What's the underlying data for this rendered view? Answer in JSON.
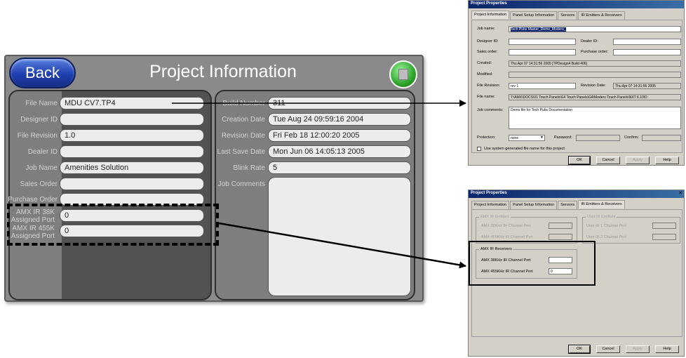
{
  "panel": {
    "back_label": "Back",
    "title": "Project Information",
    "home_icon": "home-icon",
    "left_rows": [
      {
        "label": "File Name",
        "value": "MDU CV7.TP4"
      },
      {
        "label": "Designer ID",
        "value": ""
      },
      {
        "label": "File Revision",
        "value": "1.0"
      },
      {
        "label": "Dealer ID",
        "value": ""
      },
      {
        "label": "Job Name",
        "value": "Amenities Solution"
      },
      {
        "label": "Sales Order",
        "value": ""
      },
      {
        "label": "Purchase Order",
        "value": ""
      },
      {
        "label": "AMX IR 38K Assigned Port",
        "value": "0"
      },
      {
        "label": "AMX IR 455K Assigned Port",
        "value": "0"
      }
    ],
    "right_rows": [
      {
        "label": "Build Number",
        "value": "311"
      },
      {
        "label": "Creation Date",
        "value": "Tue Aug 24 09:59:16 2004"
      },
      {
        "label": "Revision Date",
        "value": "Fri Feb 18 12:00:20 2005"
      },
      {
        "label": "Last Save Date",
        "value": "Mon Jun 06 14:05:13 2005"
      },
      {
        "label": "Blink Rate",
        "value": "5"
      },
      {
        "label": "Job Comments",
        "value": ""
      }
    ]
  },
  "dialog1": {
    "title": "Project Properties",
    "tabs": [
      "Project Information",
      "Panel Setup Information",
      "Sensors",
      "IR Emitters & Receivers"
    ],
    "job_name_label": "Job name:",
    "job_name_value": "Tech Pubs Master_Demo_Modero_",
    "designer_id_label": "Designer ID:",
    "dealer_id_label": "Dealer ID:",
    "sales_order_label": "Sales order:",
    "purchase_order_label": "Purchase order:",
    "created_label": "Created:",
    "created_value": "Thu Apr 07 14:31:56 2005 [TPDesign4 Build 406]",
    "modified_label": "Modified:",
    "file_revision_label": "File Revision:",
    "file_revision_value": "rev 1",
    "revision_date_label": "Revision Date:",
    "revision_date_value": "Thu Apr 07 14:31:56 2005",
    "file_name_label": "File name:",
    "file_name_value": "T:\\AMX\\DOCS\\01 Touch Panels\\G4 Touch Panels\\G4\\Modero Touch Panels\\NXT 6.10\\D",
    "job_comments_label": "Job comments:",
    "job_comments_value": "Demo file for Tech Pubs Documentation",
    "protection_label": "Protection:",
    "protection_value": "none",
    "password_label": "Password:",
    "confirm_label": "Confirm:",
    "checkbox_label": "Use system generated file name for this project",
    "ok": "OK",
    "cancel": "Cancel",
    "apply": "Apply",
    "help": "Help"
  },
  "dialog2": {
    "title": "Project Properties",
    "tabs": [
      "Project Information",
      "Panel Setup Information",
      "Sensors",
      "IR Emitters & Receivers"
    ],
    "emitters_group": "AMX IR Emitters",
    "emitter_rows": [
      "AMX 38KHz IR Channel Port",
      "AMX 455KHz IR Channel Port"
    ],
    "user_emitters_group": "User IR Emitters",
    "user_emitter_rows": [
      "User IR 1 Channel Port",
      "User IR 2 Channel Port"
    ],
    "receivers_group": "AMX IR Receivers",
    "receiver_rows": [
      {
        "label": "AMX 38KHz IR Channel Port",
        "value": ""
      },
      {
        "label": "AMX 455KHz IR Channel Port",
        "value": "0"
      }
    ],
    "ok": "OK",
    "cancel": "Cancel",
    "apply": "Apply",
    "help": "Help"
  }
}
